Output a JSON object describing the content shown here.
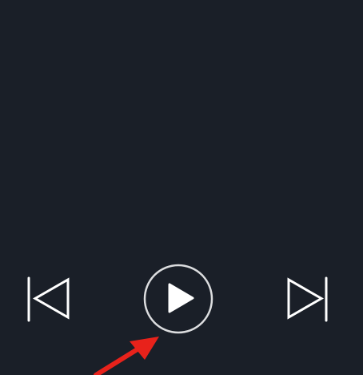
{
  "player": {
    "track_title": "",
    "track_artist": ""
  },
  "controls": {
    "previous_icon": "skip-previous-icon",
    "play_icon": "play-icon",
    "next_icon": "skip-next-icon"
  },
  "annotation": {
    "arrow_color": "#e8221b",
    "points_to": "play-button"
  },
  "colors": {
    "background": "#1a1f28",
    "icon": "#ffffff"
  }
}
